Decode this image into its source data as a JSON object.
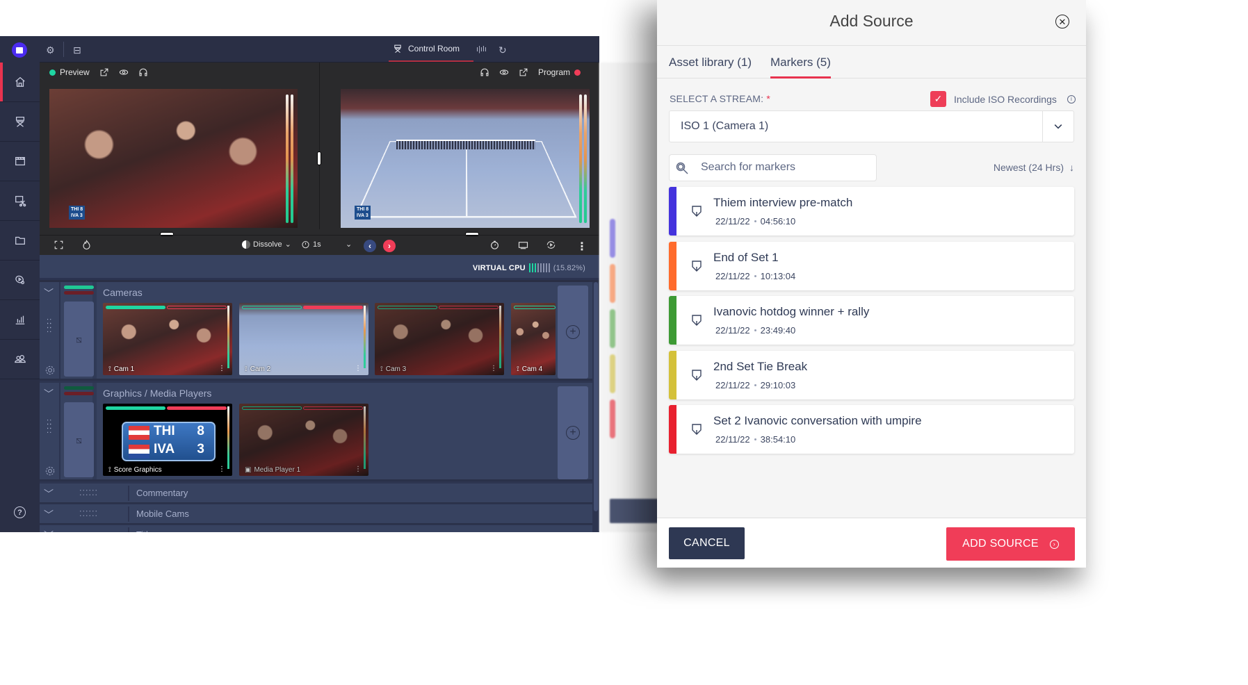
{
  "app": {
    "top_tabs": {
      "control_room": "Control Room"
    },
    "sidebar": {
      "items": [
        {
          "icon": "home-icon",
          "active": true
        },
        {
          "icon": "directors-chair-icon",
          "active": false
        },
        {
          "icon": "clapperboard-icon",
          "active": false
        },
        {
          "icon": "video-edit-icon",
          "active": false
        },
        {
          "icon": "folder-icon",
          "active": false
        },
        {
          "icon": "media-player-icon",
          "active": false
        },
        {
          "icon": "analytics-icon",
          "active": false
        },
        {
          "icon": "users-icon",
          "active": false
        }
      ],
      "help_label": "?"
    },
    "preview": {
      "label": "Preview",
      "status_color": "#1fd6a2",
      "score_bug": {
        "line1": "THI 8",
        "line2": "IVA 3"
      }
    },
    "program": {
      "label": "Program",
      "status_color": "#f03d58",
      "score_bug": {
        "line1": "THI 8",
        "line2": "IVA 3"
      }
    },
    "transition": {
      "type": "Dissolve",
      "duration": "1s"
    },
    "virtual_cpu": {
      "label": "VIRTUAL CPU",
      "percent": "(15.82%)",
      "bars_total": 8,
      "bars_on": 3
    },
    "bins": [
      {
        "title": "Cameras",
        "sources": [
          {
            "label": "Cam 1",
            "preview_active": true,
            "program_active": false
          },
          {
            "label": "Cam 2",
            "preview_active": false,
            "program_active": true
          },
          {
            "label": "Cam 3",
            "preview_active": false,
            "program_active": false
          },
          {
            "label": "Cam 4",
            "preview_active": false,
            "program_active": false
          }
        ]
      },
      {
        "title": "Graphics / Media Players",
        "sources": [
          {
            "label": "Score Graphics",
            "preview_active": true,
            "program_active": true,
            "score": {
              "team1": "THI",
              "score1": "8",
              "team2": "IVA",
              "score2": "3"
            }
          },
          {
            "label": "Media Player 1",
            "preview_active": false,
            "program_active": false
          }
        ]
      }
    ],
    "collapsed_bins": [
      "Commentary",
      "Mobile Cams",
      "Title"
    ]
  },
  "drawer": {
    "title": "Add Source",
    "tabs": [
      {
        "label": "Asset library (1)",
        "active": false
      },
      {
        "label": "Markers (5)",
        "active": true
      }
    ],
    "stream_label": "SELECT A STREAM:",
    "required_mark": "*",
    "include_iso": {
      "label": "Include ISO Recordings",
      "checked": true
    },
    "stream_value": "ISO 1 (Camera 1)",
    "search_placeholder": "Search for markers",
    "sort_label": "Newest (24 Hrs)",
    "markers": [
      {
        "title": "Thiem interview pre-match",
        "date": "22/11/22",
        "time": "04:56:10",
        "color": "#4433dd"
      },
      {
        "title": "End of Set 1",
        "date": "22/11/22",
        "time": "10:13:04",
        "color": "#ff6b2c"
      },
      {
        "title": "Ivanovic hotdog winner + rally",
        "date": "22/11/22",
        "time": "23:49:40",
        "color": "#3d9a34"
      },
      {
        "title": "2nd Set Tie Break",
        "date": "22/11/22",
        "time": "29:10:03",
        "color": "#d4c13a"
      },
      {
        "title": "Set 2 Ivanovic conversation with umpire",
        "date": "22/11/22",
        "time": "38:54:10",
        "color": "#e8202f"
      }
    ],
    "cancel_label": "CANCEL",
    "add_label": "ADD SOURCE"
  }
}
